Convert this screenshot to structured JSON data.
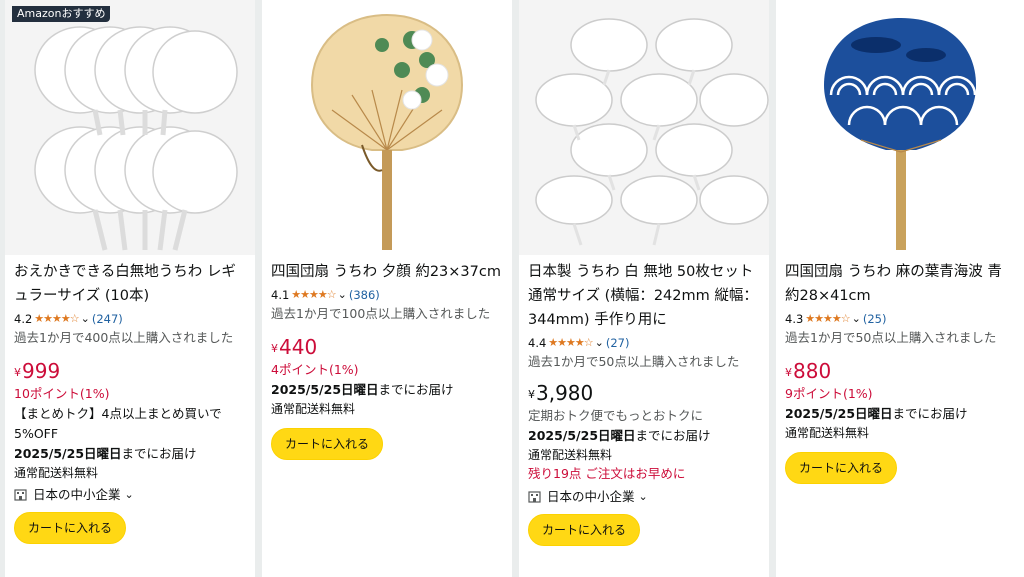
{
  "badge": "Amazonおすすめ",
  "products": [
    {
      "title": "おえかきできる白無地うちわ レギュラーサイズ (10本)",
      "rating": "4.2",
      "stars": "★★★★☆",
      "review_count": "(247)",
      "bought": "過去1か月で400点以上購入されました",
      "price_symbol": "¥",
      "price": "999",
      "points": "10ポイント(1%)",
      "promo": "【まとめトク】4点以上まとめ買いで5%OFF",
      "delivery_date": "2025/5/25日曜日",
      "delivery_suffix": "までにお届け",
      "shipping": "通常配送料無料",
      "seller": "日本の中小企業",
      "cart_button": "カートに入れる"
    },
    {
      "title": "四国団扇 うちわ 夕顔 約23×37cm",
      "rating": "4.1",
      "stars": "★★★★☆",
      "review_count": "(386)",
      "bought": "過去1か月で100点以上購入されました",
      "price_symbol": "¥",
      "price": "440",
      "points": "4ポイント(1%)",
      "delivery_date": "2025/5/25日曜日",
      "delivery_suffix": "までにお届け",
      "shipping": "通常配送料無料",
      "cart_button": "カートに入れる"
    },
    {
      "title": "日本製 うちわ 白 無地 50枚セット 通常サイズ (横幅：242mm 縦幅：344mm) 手作り用に",
      "rating": "4.4",
      "stars": "★★★★☆",
      "review_count": "(27)",
      "bought": "過去1か月で50点以上購入されました",
      "price_symbol": "¥",
      "price": "3,980",
      "subscribe": "定期おトク便でもっとおトクに",
      "delivery_date": "2025/5/25日曜日",
      "delivery_suffix": "までにお届け",
      "shipping": "通常配送料無料",
      "stock": "残り19点 ご注文はお早めに",
      "seller": "日本の中小企業",
      "cart_button": "カートに入れる"
    },
    {
      "title": "四国団扇 うちわ 麻の葉青海波 青 約28×41cm",
      "rating": "4.3",
      "stars": "★★★★☆",
      "review_count": "(25)",
      "bought": "過去1か月で50点以上購入されました",
      "price_symbol": "¥",
      "price": "880",
      "points": "9ポイント(1%)",
      "delivery_date": "2025/5/25日曜日",
      "delivery_suffix": "までにお届け",
      "shipping": "通常配送料無料",
      "cart_button": "カートに入れる"
    }
  ],
  "icons": {
    "chevron": "chevron-down-icon",
    "seller": "building-icon",
    "star": "star-icon"
  },
  "colors": {
    "price": "#cc0c39",
    "star": "#de7921",
    "link": "#2162a1",
    "button": "#ffd814",
    "page_bg": "#eaeded"
  }
}
